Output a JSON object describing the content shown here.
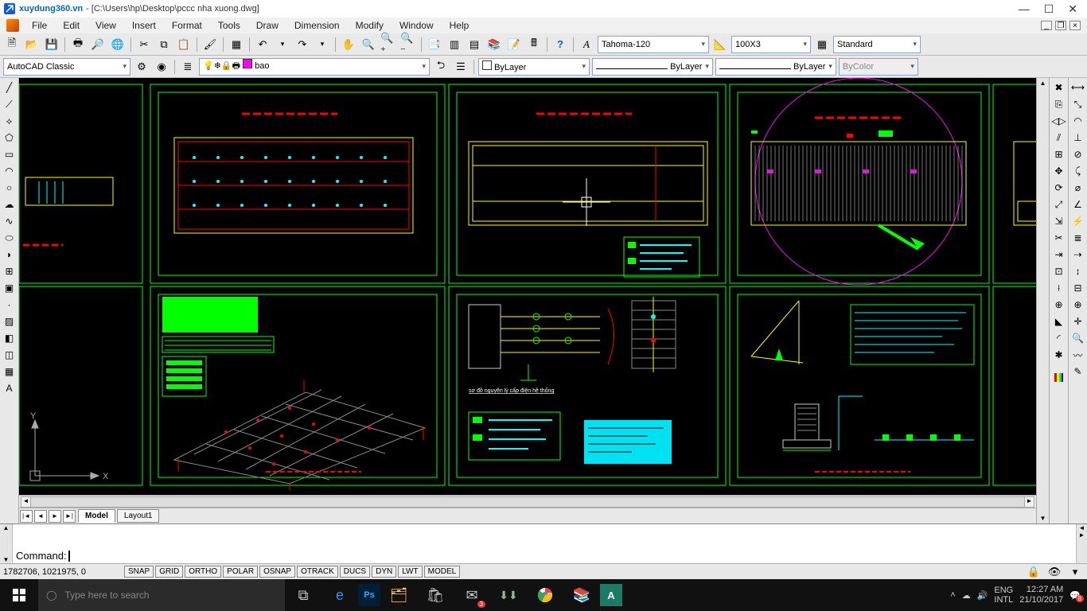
{
  "title": {
    "brand": "xuydung360.vn",
    "path": "- [C:\\Users\\hp\\Desktop\\pccc nha xuong.dwg]"
  },
  "menu": [
    "File",
    "Edit",
    "View",
    "Insert",
    "Format",
    "Tools",
    "Draw",
    "Dimension",
    "Modify",
    "Window",
    "Help"
  ],
  "toolbar": {
    "workspace": "AutoCAD Classic",
    "layer": "bao",
    "font_style": "Tahoma-120",
    "dim_style": "100X3",
    "table_style": "Standard",
    "color_mode": "ByLayer",
    "linetype": "ByLayer",
    "lineweight": "ByLayer",
    "plotstyle": "ByColor"
  },
  "tabs": {
    "model": "Model",
    "layout1": "Layout1"
  },
  "command": {
    "prompt": "Command: "
  },
  "status": {
    "coords": "1782706, 1021975, 0",
    "toggles": [
      "SNAP",
      "GRID",
      "ORTHO",
      "POLAR",
      "OSNAP",
      "OTRACK",
      "DUCS",
      "DYN",
      "LWT",
      "MODEL"
    ]
  },
  "taskbar": {
    "search_placeholder": "Type here to search",
    "lang1": "ENG",
    "lang2": "INTL",
    "time": "12:27 AM",
    "date": "21/10/2017"
  }
}
